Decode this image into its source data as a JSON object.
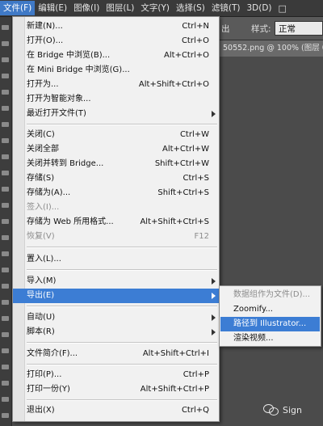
{
  "menubar": {
    "items": [
      {
        "label": "文件(F)",
        "active": true
      },
      {
        "label": "编辑(E)"
      },
      {
        "label": "图像(I)"
      },
      {
        "label": "图层(L)"
      },
      {
        "label": "文字(Y)"
      },
      {
        "label": "选择(S)"
      },
      {
        "label": "滤镜(T)"
      },
      {
        "label": "3D(D)"
      }
    ],
    "window_controls": "□"
  },
  "options_bar": {
    "partial_text": "出",
    "style_label": "样式:",
    "style_value": "正常"
  },
  "document_tab": {
    "title": "50552.png @ 100% (图层 0"
  },
  "file_menu": {
    "items": [
      {
        "label": "新建(N)...",
        "shortcut": "Ctrl+N"
      },
      {
        "label": "打开(O)...",
        "shortcut": "Ctrl+O"
      },
      {
        "label": "在 Bridge 中浏览(B)...",
        "shortcut": "Alt+Ctrl+O"
      },
      {
        "label": "在 Mini Bridge 中浏览(G)...",
        "shortcut": ""
      },
      {
        "label": "打开为...",
        "shortcut": "Alt+Shift+Ctrl+O"
      },
      {
        "label": "打开为智能对象...",
        "shortcut": ""
      },
      {
        "label": "最近打开文件(T)",
        "shortcut": "",
        "submenu": true
      },
      {
        "label": "关闭(C)",
        "shortcut": "Ctrl+W"
      },
      {
        "label": "关闭全部",
        "shortcut": "Alt+Ctrl+W"
      },
      {
        "label": "关闭并转到 Bridge...",
        "shortcut": "Shift+Ctrl+W"
      },
      {
        "label": "存储(S)",
        "shortcut": "Ctrl+S"
      },
      {
        "label": "存储为(A)...",
        "shortcut": "Shift+Ctrl+S"
      },
      {
        "label": "签入(I)...",
        "shortcut": "",
        "disabled": true
      },
      {
        "label": "存储为 Web 所用格式...",
        "shortcut": "Alt+Shift+Ctrl+S"
      },
      {
        "label": "恢复(V)",
        "shortcut": "F12",
        "disabled": true
      },
      {
        "label": "置入(L)...",
        "shortcut": ""
      },
      {
        "label": "导入(M)",
        "shortcut": "",
        "submenu": true
      },
      {
        "label": "导出(E)",
        "shortcut": "",
        "submenu": true,
        "highlight": true
      },
      {
        "label": "自动(U)",
        "shortcut": "",
        "submenu": true
      },
      {
        "label": "脚本(R)",
        "shortcut": "",
        "submenu": true
      },
      {
        "label": "文件简介(F)...",
        "shortcut": "Alt+Shift+Ctrl+I"
      },
      {
        "label": "打印(P)...",
        "shortcut": "Ctrl+P"
      },
      {
        "label": "打印一份(Y)",
        "shortcut": "Alt+Shift+Ctrl+P"
      },
      {
        "label": "退出(X)",
        "shortcut": "Ctrl+Q"
      }
    ]
  },
  "export_submenu": {
    "items": [
      {
        "label": "数据组作为文件(D)...",
        "disabled": true
      },
      {
        "label": "Zoomify..."
      },
      {
        "label": "路径到 Illustrator...",
        "highlight": true
      },
      {
        "label": "渲染视频..."
      }
    ]
  },
  "watermark": {
    "text": "Sign"
  },
  "colors": {
    "menu_highlight": "#3c7dd4",
    "menubar_bg": "#3a3a3a",
    "menu_bg": "#f1f1f1",
    "disabled_text": "#8c8c8c"
  }
}
